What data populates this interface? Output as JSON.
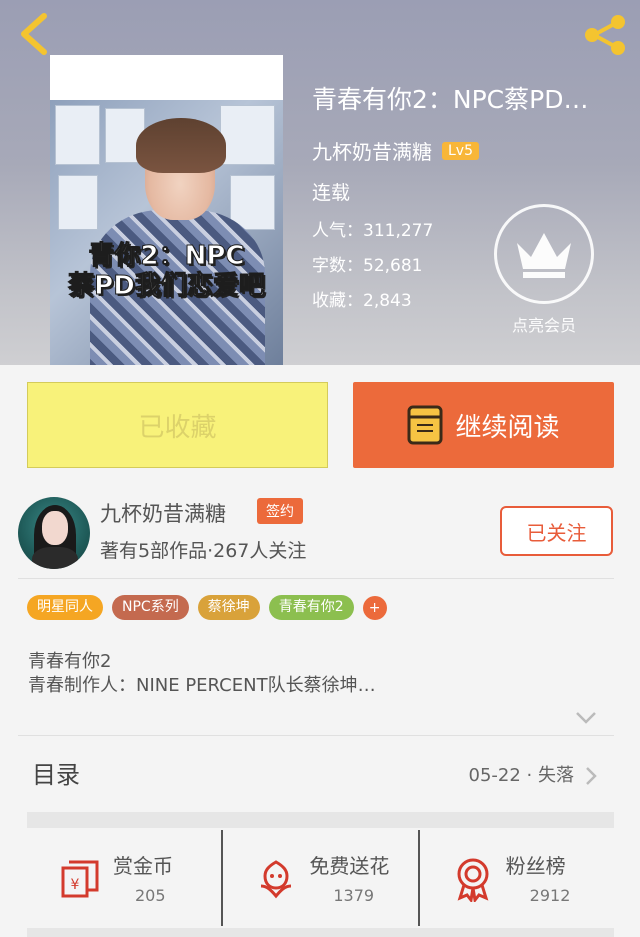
{
  "header": {
    "title": "青春有你2：NPC蔡PD…",
    "cover_text_line1": "青你2：NPC",
    "cover_text_line2": "蔡PD我们恋爱吧",
    "author": "九杯奶昔满糖",
    "level": "Lv5",
    "status": "连载",
    "popularity": "人气：311,277",
    "word_count": "字数：52,681",
    "favorites": "收藏：2,843",
    "vip_label": "点亮会员"
  },
  "actions": {
    "collected_label": "已收藏",
    "continue_label": "继续阅读"
  },
  "author_card": {
    "name": "九杯奶昔满糖",
    "sign_badge": "签约",
    "meta": "著有5部作品·267人关注",
    "follow_label": "已关注"
  },
  "tags": [
    {
      "label": "明星同人",
      "color": "#f5a623"
    },
    {
      "label": "NPC系列",
      "color": "#c46a4f"
    },
    {
      "label": "蔡徐坤",
      "color": "#d9a23a"
    },
    {
      "label": "青春有你2",
      "color": "#8cbf4f"
    }
  ],
  "tag_add": "+",
  "synopsis": {
    "line1": "青春有你2",
    "line2": "青春制作人：NINE PERCENT队长蔡徐坤…"
  },
  "catalog": {
    "title": "目录",
    "latest": "05-22 · 失落"
  },
  "stats": [
    {
      "label": "赏金币",
      "count": "205",
      "icon": "coin-red-envelope-icon"
    },
    {
      "label": "免费送花",
      "count": "1379",
      "icon": "flower-icon"
    },
    {
      "label": "粉丝榜",
      "count": "2912",
      "icon": "badge-ribbon-icon"
    }
  ],
  "colors": {
    "accent": "#ec6a3b",
    "collected_bg": "#f8f27a",
    "level_badge": "#f8b638"
  }
}
